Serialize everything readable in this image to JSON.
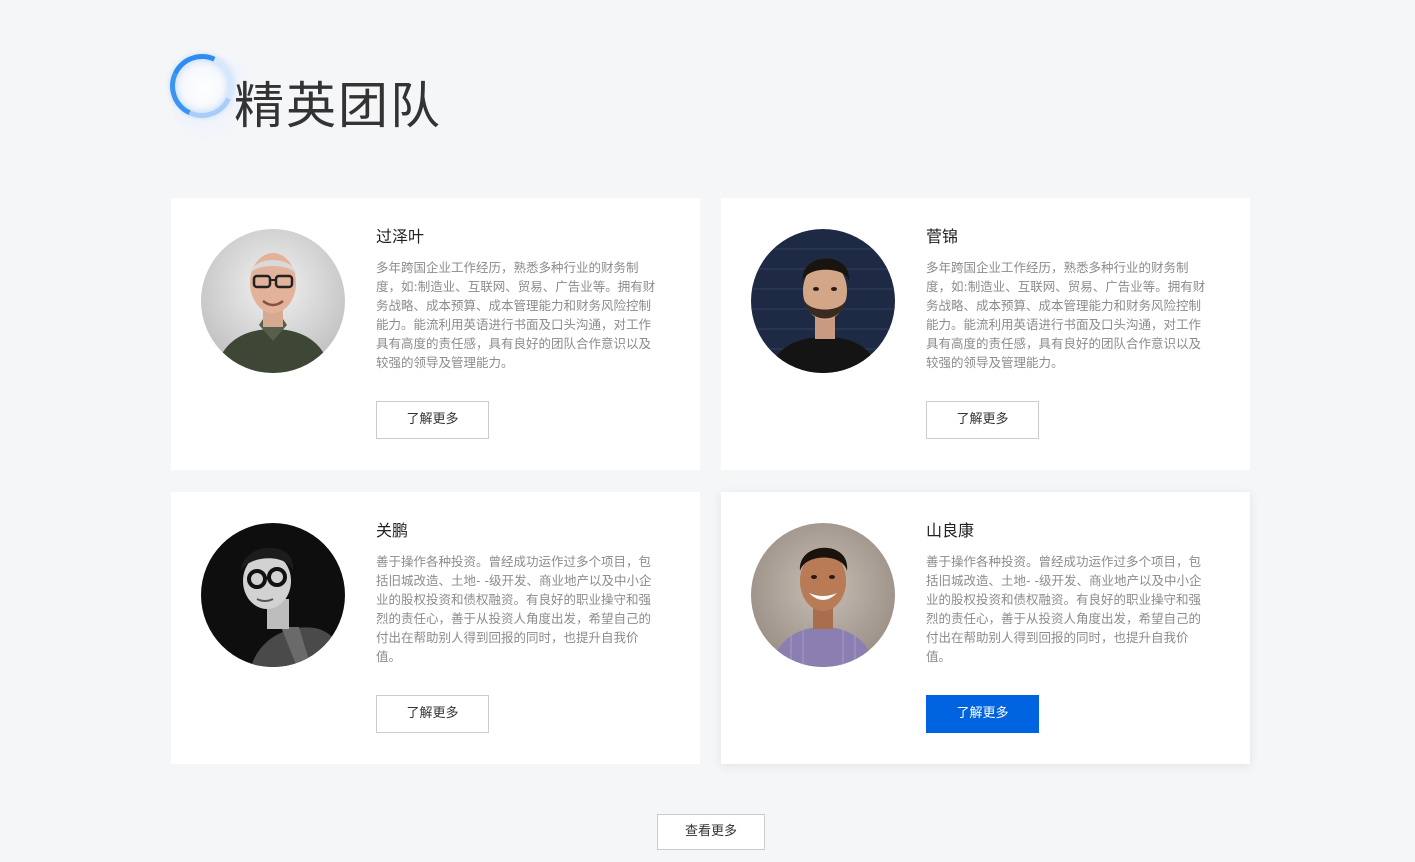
{
  "section": {
    "title": "精英团队"
  },
  "members": [
    {
      "name": "过泽叶",
      "bio": "多年跨国企业工作经历，熟悉多种行业的财务制度，如:制造业、互联网、贸易、广告业等。拥有财务战略、成本预算、成本管理能力和财务风险控制能力。能流利用英语进行书面及口头沟通，对工作具有高度的责任感，具有良好的团队合作意识以及较强的领导及管理能力。",
      "button_label": "了解更多"
    },
    {
      "name": "菅锦",
      "bio": "多年跨国企业工作经历，熟悉多种行业的财务制度，如:制造业、互联网、贸易、广告业等。拥有财务战略、成本预算、成本管理能力和财务风险控制能力。能流利用英语进行书面及口头沟通，对工作具有高度的责任感，具有良好的团队合作意识以及较强的领导及管理能力。",
      "button_label": "了解更多"
    },
    {
      "name": "关鹏",
      "bio": "善于操作各种投资。曾经成功运作过多个项目，包括旧城改造、土地- -级开发、商业地产以及中小企业的股权投资和债权融资。有良好的职业操守和强烈的责任心，善于从投资人角度出发，希望自己的付出在帮助别人得到回报的同时，也提升自我价值。",
      "button_label": "了解更多"
    },
    {
      "name": "山良康",
      "bio": "善于操作各种投资。曾经成功运作过多个项目，包括旧城改造、土地- -级开发、商业地产以及中小企业的股权投资和债权融资。有良好的职业操守和强烈的责任心，善于从投资人角度出发，希望自己的付出在帮助别人得到回报的同时，也提升自我价值。",
      "button_label": "了解更多"
    }
  ],
  "footer": {
    "more_label": "查看更多"
  },
  "colors": {
    "page_background": "#f5f6f8",
    "card_background": "#ffffff",
    "primary": "#0063e0",
    "accent_ring": "#2d8cf0",
    "title_text": "#333333",
    "body_text": "#8c8c8c"
  }
}
